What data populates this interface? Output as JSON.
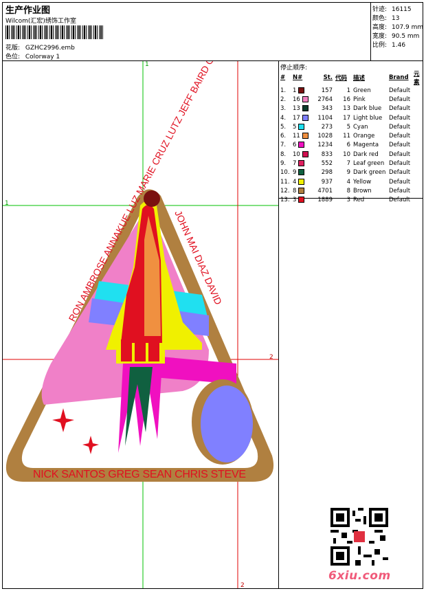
{
  "header": {
    "title": "生产作业图",
    "company": "Wilcom(汇宏)绣饰工作室",
    "design_label": "花版:",
    "design_value": "GZHC2996.emb",
    "colorway_label": "色位:",
    "colorway_value": "Colorway 1"
  },
  "stats": {
    "stitches_label": "针迹:",
    "stitches_value": "16115",
    "colors_label": "颜色:",
    "colors_value": "13",
    "height_label": "高度:",
    "height_value": "107.9 mm",
    "width_label": "宽度:",
    "width_value": "90.5 mm",
    "scale_label": "比例:",
    "scale_value": "1.46"
  },
  "sequence": {
    "title": "停止顺序:",
    "headers": [
      "#",
      "N#",
      "St.",
      "代码",
      "描述",
      "Brand",
      "元素"
    ],
    "rows": [
      {
        "idx": "1.",
        "n": "1",
        "st": "157",
        "code": "1",
        "desc": "Green",
        "brand": "Default",
        "color": "#7a1010"
      },
      {
        "idx": "2.",
        "n": "16",
        "st": "2764",
        "code": "16",
        "desc": "Pink",
        "brand": "Default",
        "color": "#f080c0"
      },
      {
        "idx": "3.",
        "n": "13",
        "st": "343",
        "code": "13",
        "desc": "Dark blue",
        "brand": "Default",
        "color": "#0a3a2a"
      },
      {
        "idx": "4.",
        "n": "17",
        "st": "1104",
        "code": "17",
        "desc": "Light blue",
        "brand": "Default",
        "color": "#8080ff"
      },
      {
        "idx": "5.",
        "n": "5",
        "st": "273",
        "code": "5",
        "desc": "Cyan",
        "brand": "Default",
        "color": "#20e0f0"
      },
      {
        "idx": "6.",
        "n": "11",
        "st": "1028",
        "code": "11",
        "desc": "Orange",
        "brand": "Default",
        "color": "#f09040"
      },
      {
        "idx": "7.",
        "n": "6",
        "st": "1234",
        "code": "6",
        "desc": "Magenta",
        "brand": "Default",
        "color": "#f010c0"
      },
      {
        "idx": "8.",
        "n": "10",
        "st": "833",
        "code": "10",
        "desc": "Dark red",
        "brand": "Default",
        "color": "#d01050"
      },
      {
        "idx": "9.",
        "n": "7",
        "st": "552",
        "code": "7",
        "desc": "Leaf green",
        "brand": "Default",
        "color": "#e02060"
      },
      {
        "idx": "10.",
        "n": "9",
        "st": "298",
        "code": "9",
        "desc": "Dark green",
        "brand": "Default",
        "color": "#106040"
      },
      {
        "idx": "11.",
        "n": "4",
        "st": "937",
        "code": "4",
        "desc": "Yellow",
        "brand": "Default",
        "color": "#f0f000"
      },
      {
        "idx": "12.",
        "n": "8",
        "st": "4701",
        "code": "8",
        "desc": "Brown",
        "brand": "Default",
        "color": "#b08040"
      },
      {
        "idx": "13.",
        "n": "3",
        "st": "1889",
        "code": "3",
        "desc": "Red",
        "brand": "Default",
        "color": "#e01020"
      }
    ]
  },
  "guides": {
    "v1": "1",
    "h1": "1",
    "h2": "2",
    "v2": "2"
  },
  "patch": {
    "ring_top_text": "RON AMBROSE ANNAKUE LUZ MARIE CRUZ LUTZ JEFF BAIRD GEORGE MARIE",
    "ring_right_text": "JOHN MAI DIAZ DAVID",
    "bottom_text": "NICK SANTOS GREG SEAN CHRIS STEVE"
  },
  "watermark": "6xiu.com"
}
